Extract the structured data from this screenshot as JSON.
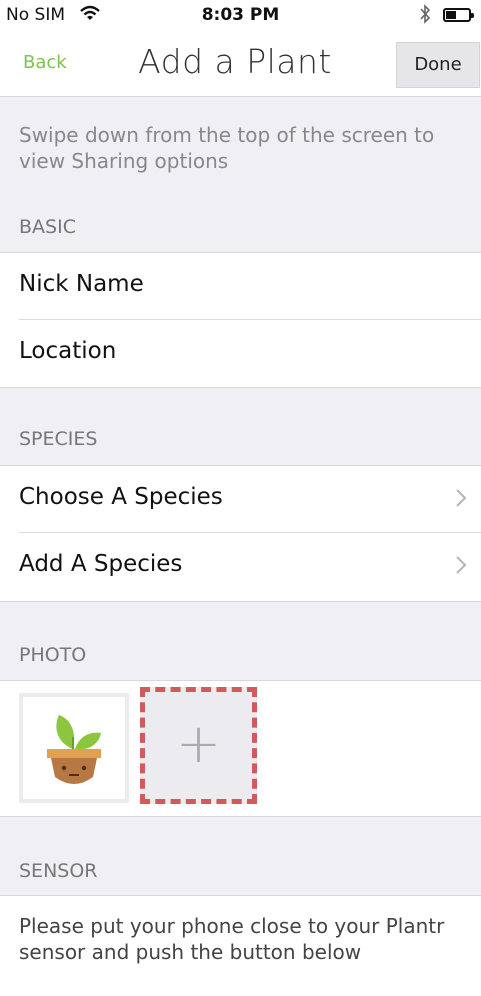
{
  "status_bar": {
    "carrier": "No SIM",
    "time": "8:03 PM",
    "bluetooth_icon": "bluetooth-icon",
    "wifi_icon": "wifi-icon",
    "battery_level": 0.45
  },
  "nav": {
    "back_label": "Back",
    "title": "Add a Plant",
    "done_label": "Done"
  },
  "hint": "Swipe down from the top of the screen to view Sharing options",
  "sections": {
    "basic": {
      "header": "BASIC",
      "nick_name_label": "Nick Name",
      "location_label": "Location"
    },
    "species": {
      "header": "SPECIES",
      "choose_label": "Choose A Species",
      "add_label": "Add A Species"
    },
    "photo": {
      "header": "PHOTO",
      "plus_glyph": "+"
    },
    "sensor": {
      "header": "SENSOR",
      "instructions": "Please put your phone close to your Plantr sensor and push the button below"
    }
  },
  "colors": {
    "accent_green": "#7cc34f",
    "dashed_red": "#d15b5b",
    "background": "#efeff4"
  }
}
